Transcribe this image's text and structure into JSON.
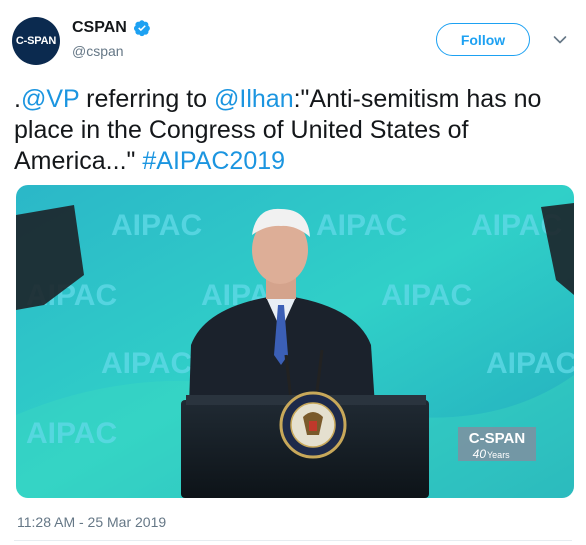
{
  "account": {
    "avatar_text": "C-SPAN",
    "name": "CSPAN",
    "handle": "@cspan",
    "verified_icon": "verified-badge-icon"
  },
  "follow_label": "Follow",
  "tweet": {
    "part1": ".",
    "mention1": "@VP",
    "part2": " referring to ",
    "mention2": "@Ilhan",
    "part3": ":\"Anti-semitism has no place in the Congress of United States of America...\" ",
    "hashtag": "#AIPAC2019"
  },
  "media": {
    "backdrop_words": [
      "AIPAC",
      "AIPAC",
      "AIPAC",
      "AIPAC",
      "AIPAC",
      "AIPAC",
      "AIPAC",
      "AIPAC",
      "AIPAC"
    ],
    "watermark": "C-SPAN",
    "watermark_sub_number": "40",
    "watermark_sub_text": "Years"
  },
  "timestamp": "11:28 AM - 25 Mar 2019",
  "colors": {
    "accent": "#1da1f2",
    "link": "#1b95e0",
    "stage": "#2fc7c4"
  }
}
